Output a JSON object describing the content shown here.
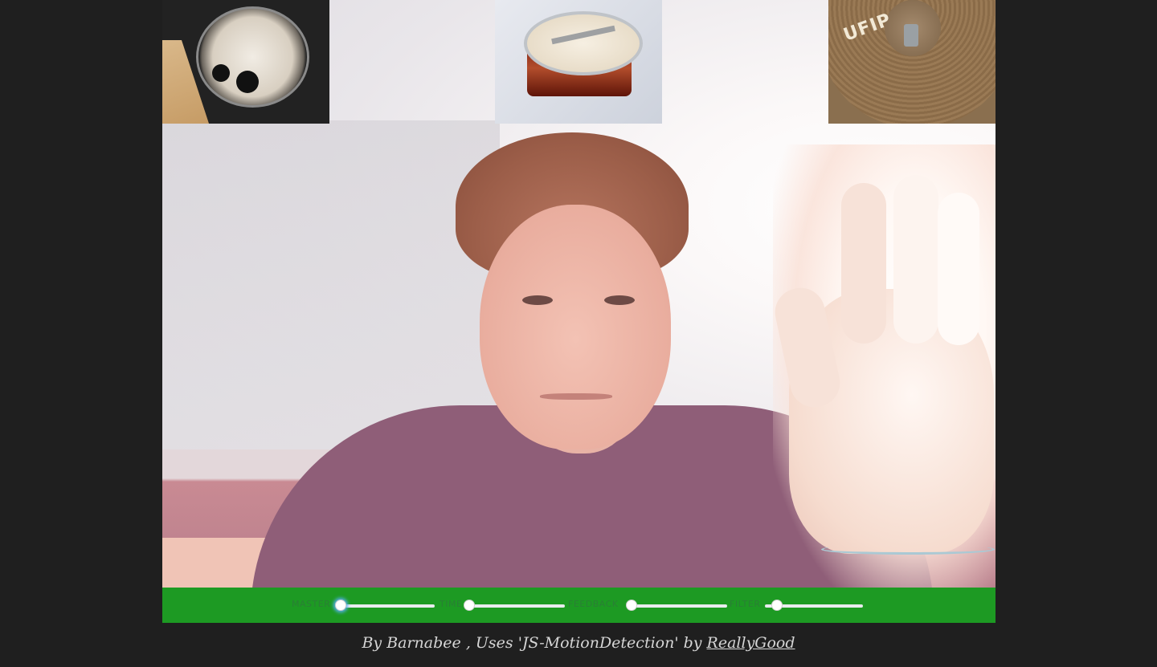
{
  "thumbnails": [
    {
      "name": "kick-drum"
    },
    {
      "name": "snare-drum"
    },
    {
      "name": "cymbal",
      "logo_text": "UFIP"
    }
  ],
  "controls": [
    {
      "label": "MASTER",
      "value": 0.0
    },
    {
      "label": "TIME",
      "value": 0.0
    },
    {
      "label": "FEEDBACK",
      "value": 0.0
    },
    {
      "label": "FILTER",
      "value": 0.1
    }
  ],
  "credit": {
    "prefix": "By Barnabee , Uses 'JS-MotionDetection' by",
    "link_text": "ReallyGood"
  },
  "colors": {
    "background": "#1f1f1f",
    "controls_bar": "#1d9a23",
    "credit_text": "#d6d6d6"
  }
}
